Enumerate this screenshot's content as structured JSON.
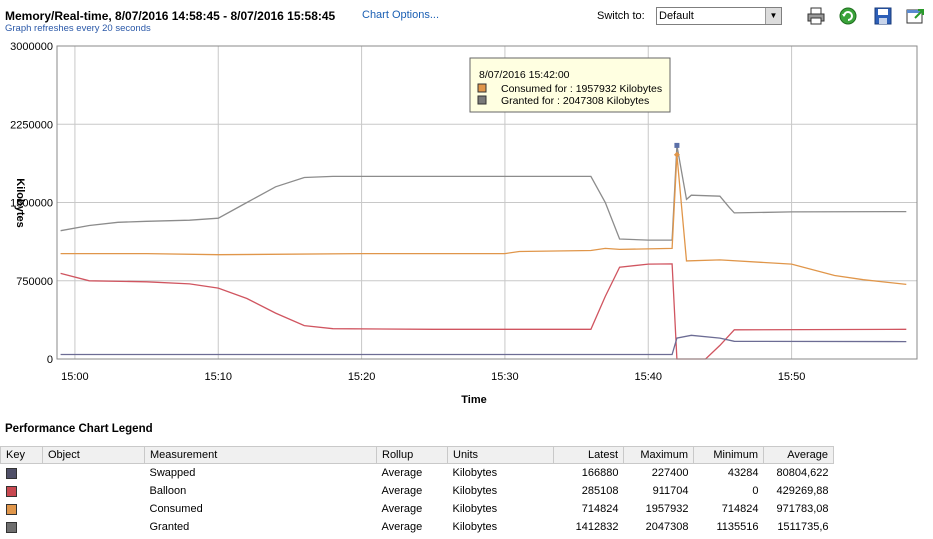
{
  "header": {
    "title": "Memory/Real-time, 8/07/2016 14:58:45 - 8/07/2016 15:58:45",
    "chart_options_link": "Chart Options...",
    "refresh_note": "Graph refreshes every 20 seconds",
    "switch_label": "Switch to:",
    "switch_value": "Default"
  },
  "toolbar": {
    "icons": [
      "print-icon",
      "refresh-icon",
      "save-icon",
      "popout-icon"
    ]
  },
  "tooltip": {
    "time": "8/07/2016 15:42:00",
    "lines": [
      {
        "text": "Consumed for : 1957932 Kilobytes",
        "color": "#e0964a"
      },
      {
        "text": "Granted for : 2047308 Kilobytes",
        "color": "#7a7a7a"
      }
    ]
  },
  "chart_data": {
    "type": "line",
    "xlabel": "Time",
    "ylabel": "Kilobytes",
    "ylim": [
      0,
      3000000
    ],
    "yticks": [
      "3000000",
      "2250000",
      "1500000",
      "750000",
      "0"
    ],
    "xlim_minutes": [
      14.75,
      15.97
    ],
    "xticks": [
      "15:00",
      "15:10",
      "15:20",
      "15:30",
      "15:40",
      "15:50"
    ],
    "grid": true,
    "series": [
      {
        "name": "Granted",
        "color": "#8c8c8c",
        "points": [
          [
            "14:59",
            1230000
          ],
          [
            "15:01",
            1280000
          ],
          [
            "15:03",
            1310000
          ],
          [
            "15:05",
            1320000
          ],
          [
            "15:08",
            1330000
          ],
          [
            "15:10",
            1350000
          ],
          [
            "15:12",
            1500000
          ],
          [
            "15:14",
            1650000
          ],
          [
            "15:16",
            1740000
          ],
          [
            "15:18",
            1750000
          ],
          [
            "15:25",
            1750000
          ],
          [
            "15:36",
            1750000
          ],
          [
            "15:37",
            1500000
          ],
          [
            "15:38",
            1150000
          ],
          [
            "15:40",
            1140000
          ],
          [
            "15:41:40",
            1140000
          ],
          [
            "15:42",
            2047308
          ],
          [
            "15:42:40",
            1530000
          ],
          [
            "15:43",
            1570000
          ],
          [
            "15:45",
            1560000
          ],
          [
            "15:45:40",
            1450000
          ],
          [
            "15:46",
            1400000
          ],
          [
            "15:50",
            1410000
          ],
          [
            "15:58",
            1412832
          ]
        ]
      },
      {
        "name": "Consumed",
        "color": "#e0964a",
        "points": [
          [
            "14:59",
            1010000
          ],
          [
            "15:05",
            1010000
          ],
          [
            "15:10",
            1000000
          ],
          [
            "15:20",
            1010000
          ],
          [
            "15:30",
            1010000
          ],
          [
            "15:31",
            1030000
          ],
          [
            "15:36",
            1040000
          ],
          [
            "15:37",
            1060000
          ],
          [
            "15:38",
            1050000
          ],
          [
            "15:41:40",
            1060000
          ],
          [
            "15:42",
            1957932
          ],
          [
            "15:42:40",
            940000
          ],
          [
            "15:45",
            950000
          ],
          [
            "15:50",
            910000
          ],
          [
            "15:53",
            800000
          ],
          [
            "15:55",
            760000
          ],
          [
            "15:58",
            714824
          ]
        ]
      },
      {
        "name": "Balloon",
        "color": "#d05560",
        "points": [
          [
            "14:59",
            820000
          ],
          [
            "15:01",
            750000
          ],
          [
            "15:05",
            740000
          ],
          [
            "15:08",
            720000
          ],
          [
            "15:10",
            680000
          ],
          [
            "15:12",
            580000
          ],
          [
            "15:14",
            440000
          ],
          [
            "15:16",
            320000
          ],
          [
            "15:18",
            290000
          ],
          [
            "15:25",
            285000
          ],
          [
            "15:36",
            285000
          ],
          [
            "15:37",
            600000
          ],
          [
            "15:38",
            880000
          ],
          [
            "15:40",
            910000
          ],
          [
            "15:41:40",
            911704
          ],
          [
            "15:42",
            0
          ],
          [
            "15:44",
            0
          ],
          [
            "15:45",
            130000
          ],
          [
            "15:46",
            280000
          ],
          [
            "15:58",
            285108
          ]
        ]
      },
      {
        "name": "Swapped",
        "color": "#6c6c94",
        "points": [
          [
            "14:59",
            43284
          ],
          [
            "15:30",
            43284
          ],
          [
            "15:41:40",
            43284
          ],
          [
            "15:42",
            200000
          ],
          [
            "15:43",
            227400
          ],
          [
            "15:45",
            200000
          ],
          [
            "15:46",
            170000
          ],
          [
            "15:58",
            166880
          ]
        ]
      }
    ]
  },
  "legend": {
    "title": "Performance Chart Legend",
    "columns": [
      "Key",
      "Object",
      "Measurement",
      "Rollup",
      "Units",
      "Latest",
      "Maximum",
      "Minimum",
      "Average"
    ],
    "rows": [
      {
        "key_color": "#505068",
        "object": "",
        "measurement": "Swapped",
        "rollup": "Average",
        "units": "Kilobytes",
        "latest": "166880",
        "maximum": "227400",
        "minimum": "43284",
        "average": "80804,622"
      },
      {
        "key_color": "#c84850",
        "object": "",
        "measurement": "Balloon",
        "rollup": "Average",
        "units": "Kilobytes",
        "latest": "285108",
        "maximum": "911704",
        "minimum": "0",
        "average": "429269,88"
      },
      {
        "key_color": "#e0964a",
        "object": "",
        "measurement": "Consumed",
        "rollup": "Average",
        "units": "Kilobytes",
        "latest": "714824",
        "maximum": "1957932",
        "minimum": "714824",
        "average": "971783,08"
      },
      {
        "key_color": "#6e6e6e",
        "object": "",
        "measurement": "Granted",
        "rollup": "Average",
        "units": "Kilobytes",
        "latest": "1412832",
        "maximum": "2047308",
        "minimum": "1135516",
        "average": "1511735,6"
      }
    ]
  }
}
